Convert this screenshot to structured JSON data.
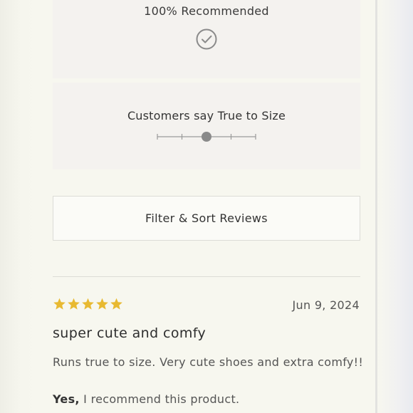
{
  "summary": {
    "recommended_text": "100% Recommended",
    "check_icon": "check-circle-icon",
    "size_text": "Customers say True to Size",
    "size_scale": {
      "ticks": 5,
      "selected_index": 2,
      "level": 0.5
    }
  },
  "filter": {
    "label": "Filter & Sort Reviews"
  },
  "review": {
    "rating": 5,
    "max_rating": 5,
    "star_icon": "star-icon",
    "star_color": "#e8b931",
    "date": "Jun 9, 2024",
    "title": "super cute and comfy",
    "body": "Runs true to size. Very cute shoes and extra comfy!!",
    "recommend_yes": "Yes,",
    "recommend_rest": " I recommend this product."
  },
  "colors": {
    "panel_background": "#f4f2ef",
    "text": "#333333",
    "muted_text": "#555555",
    "scale_color": "#8a8a8a"
  }
}
